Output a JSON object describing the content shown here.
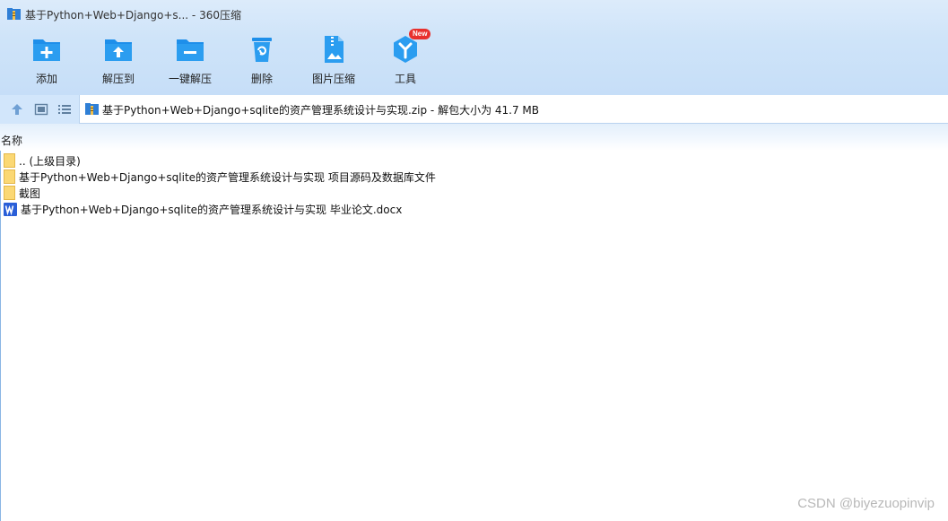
{
  "window": {
    "title": "基于Python+Web+Django+s... - 360压缩"
  },
  "toolbar": {
    "items": [
      {
        "label": "添加",
        "icon": "add-folder-icon"
      },
      {
        "label": "解压到",
        "icon": "extract-to-icon"
      },
      {
        "label": "一键解压",
        "icon": "one-click-extract-icon"
      },
      {
        "label": "删除",
        "icon": "delete-icon"
      },
      {
        "label": "图片压缩",
        "icon": "image-compress-icon"
      },
      {
        "label": "工具",
        "icon": "tools-icon",
        "badge": "New"
      }
    ]
  },
  "nav": {
    "icons": [
      "up-arrow-icon",
      "thumbnail-view-icon",
      "list-view-icon"
    ]
  },
  "address": {
    "text": "基于Python+Web+Django+sqlite的资产管理系统设计与实现.zip - 解包大小为 41.7 MB"
  },
  "list": {
    "column_name": "名称",
    "rows": [
      {
        "name": ".. (上级目录)",
        "type": "folder"
      },
      {
        "name": "基于Python+Web+Django+sqlite的资产管理系统设计与实现 项目源码及数据库文件",
        "type": "folder"
      },
      {
        "name": "截图",
        "type": "folder"
      },
      {
        "name": "基于Python+Web+Django+sqlite的资产管理系统设计与实现 毕业论文.docx",
        "type": "word-doc"
      }
    ]
  },
  "watermark": "CSDN @biyezuopinvip",
  "colors": {
    "accent": "#1e8fea",
    "toolbar_bg": "#cfe4f9",
    "badge": "#e8302d"
  }
}
